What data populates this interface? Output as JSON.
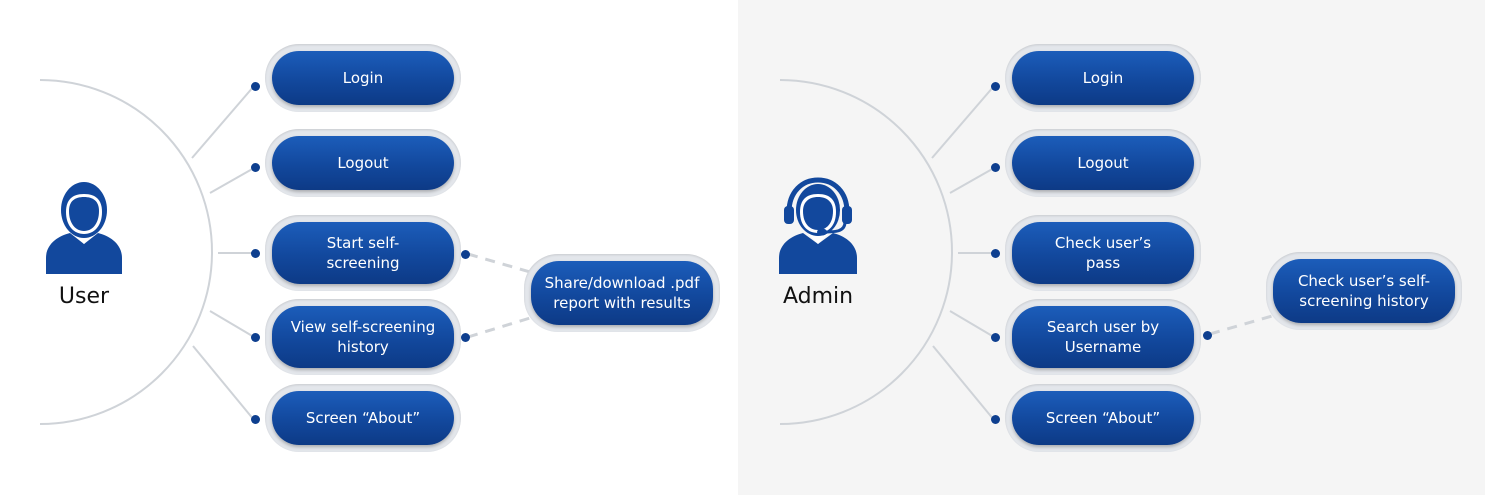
{
  "user": {
    "actor_label": "User",
    "actor_icon": "user-icon",
    "actions": [
      {
        "label": "Login"
      },
      {
        "label": "Logout"
      },
      {
        "label": "Start self-screening"
      },
      {
        "label": "View self-screening history"
      },
      {
        "label": "Screen “About”"
      }
    ],
    "result": {
      "label": "Share/download .pdf report with results"
    }
  },
  "admin": {
    "actor_label": "Admin",
    "actor_icon": "headset-operator-icon",
    "actions": [
      {
        "label": "Login"
      },
      {
        "label": "Logout"
      },
      {
        "label": "Check user’s pass"
      },
      {
        "label": "Search user by Username"
      },
      {
        "label": "Screen “About”"
      }
    ],
    "result": {
      "label": "Check user’s self-screening history"
    }
  },
  "colors": {
    "pill": "#12489d",
    "dot": "#0e3f8f",
    "connector": "#cfd3d8",
    "admin_background": "#f5f5f5"
  }
}
